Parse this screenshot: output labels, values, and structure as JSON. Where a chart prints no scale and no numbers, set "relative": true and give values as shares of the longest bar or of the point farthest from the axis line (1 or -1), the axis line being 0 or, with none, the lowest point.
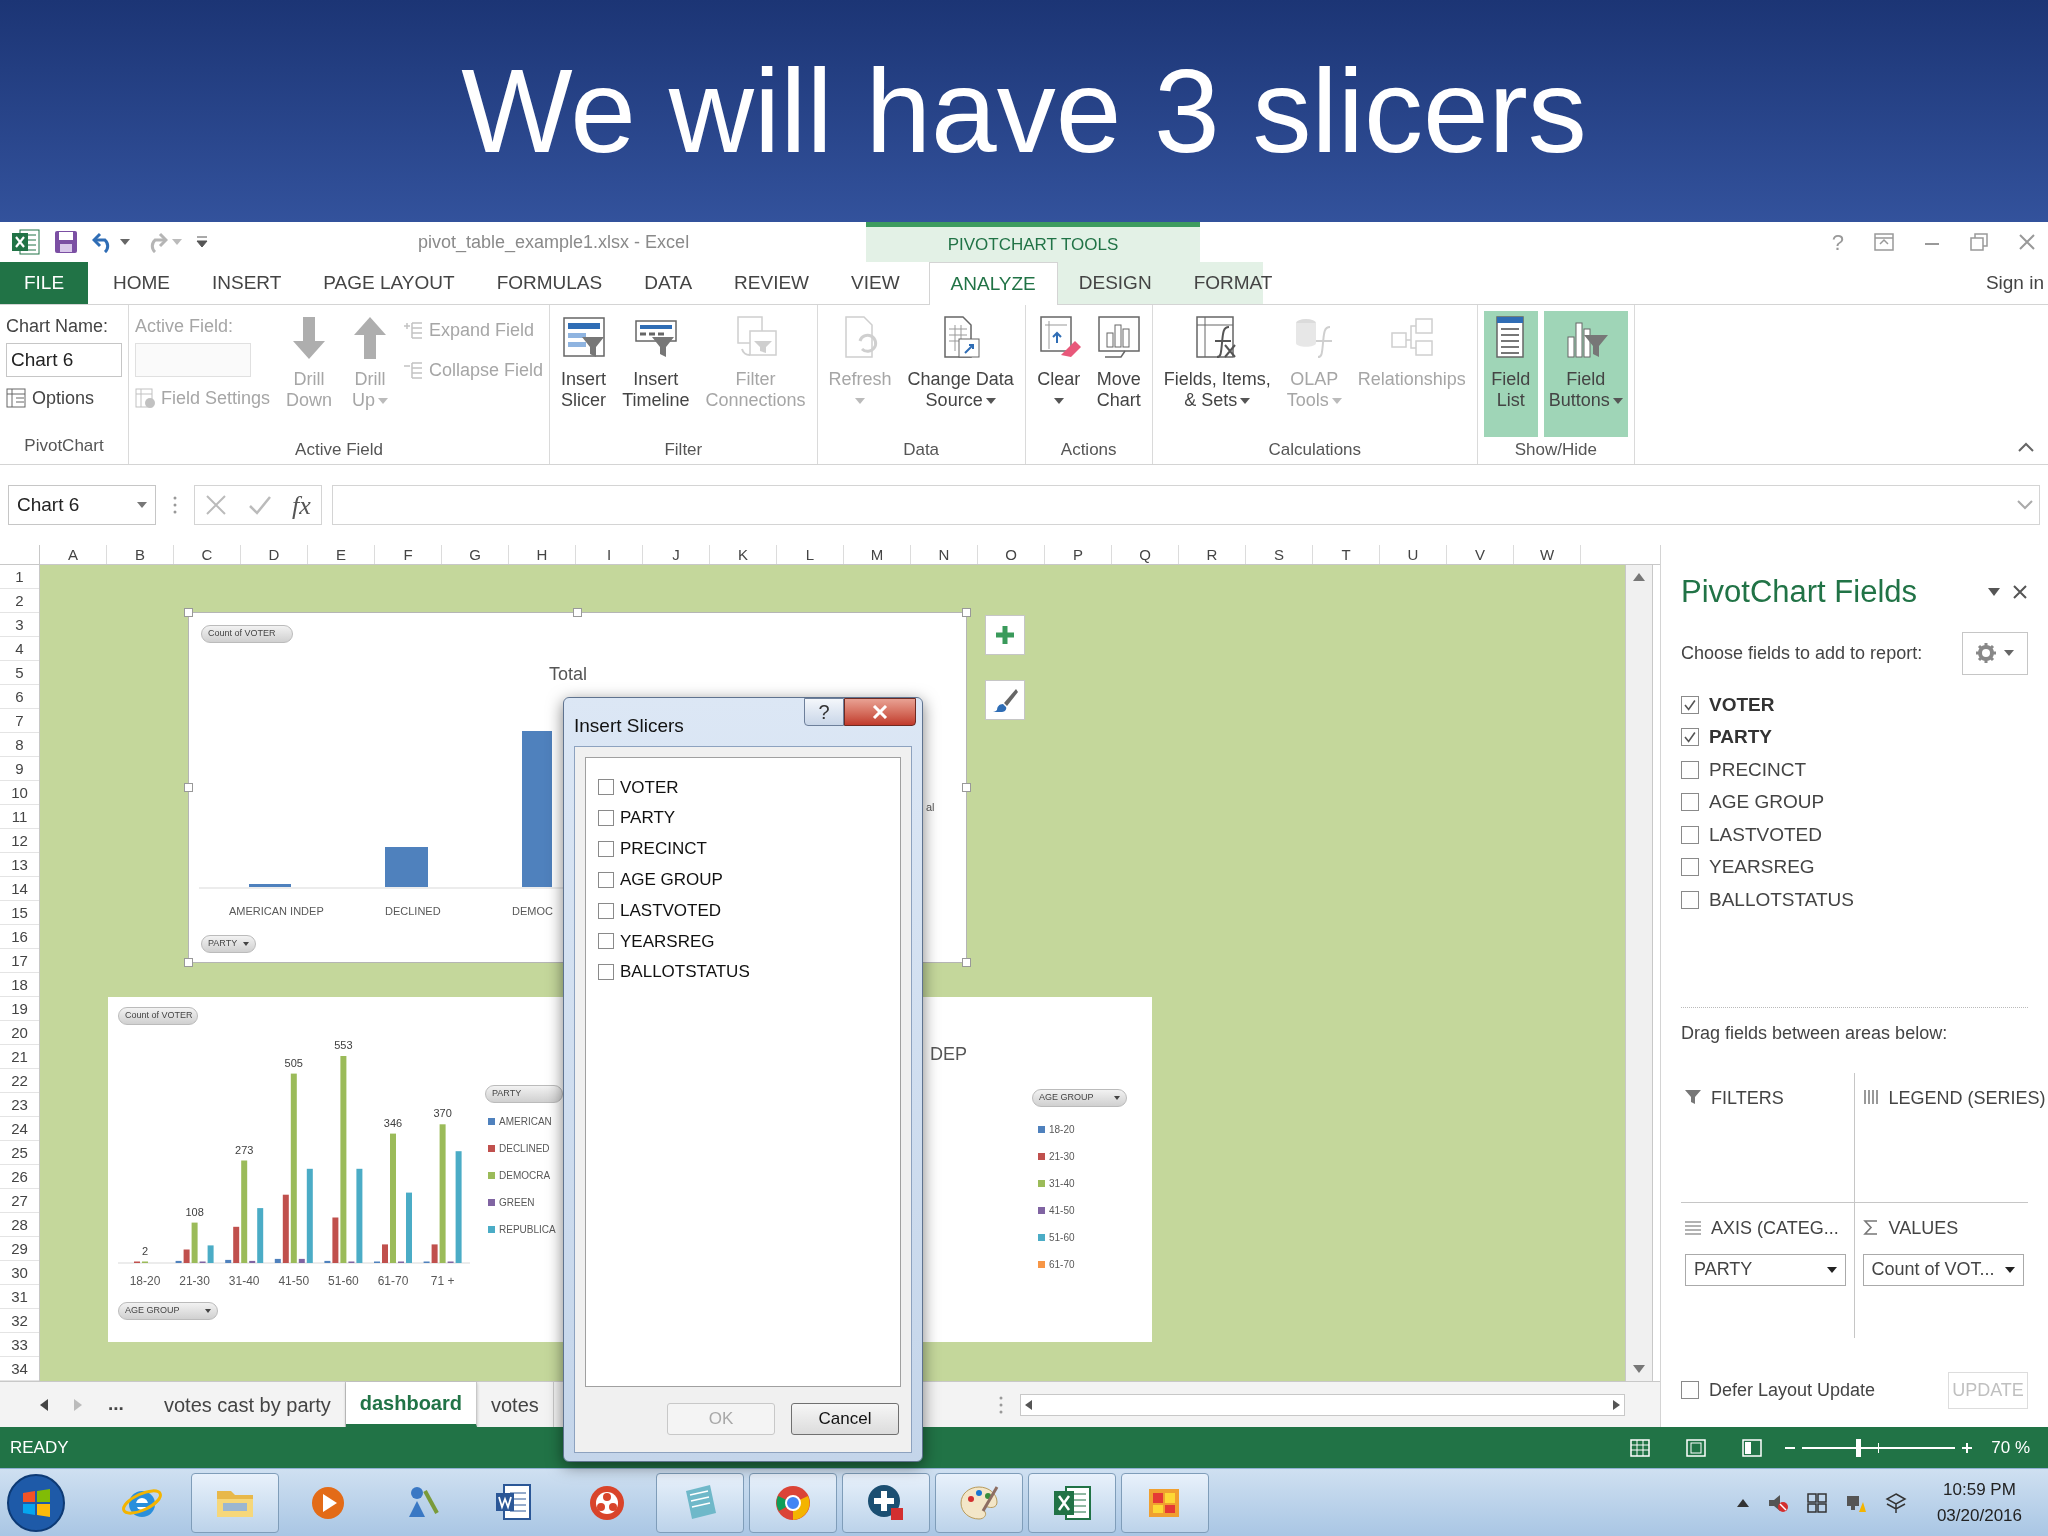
{
  "slide_title": "We will have 3 slicers",
  "title_bar": {
    "document_title": "pivot_table_example1.xlsx - Excel",
    "context_header": "PIVOTCHART TOOLS",
    "help": "?",
    "sign_in": "Sign in"
  },
  "ribbon_tabs": [
    {
      "label": "FILE",
      "kind": "file",
      "selected": false
    },
    {
      "label": "HOME",
      "kind": "tab",
      "selected": false
    },
    {
      "label": "INSERT",
      "kind": "tab",
      "selected": false
    },
    {
      "label": "PAGE LAYOUT",
      "kind": "tab",
      "selected": false
    },
    {
      "label": "FORMULAS",
      "kind": "tab",
      "selected": false
    },
    {
      "label": "DATA",
      "kind": "tab",
      "selected": false
    },
    {
      "label": "REVIEW",
      "kind": "tab",
      "selected": false
    },
    {
      "label": "VIEW",
      "kind": "tab",
      "selected": false
    },
    {
      "label": "ANALYZE",
      "kind": "context",
      "selected": true
    },
    {
      "label": "DESIGN",
      "kind": "context",
      "selected": false
    },
    {
      "label": "FORMAT",
      "kind": "context",
      "selected": false
    }
  ],
  "ribbon_groups": [
    {
      "label": "PivotChart",
      "columns": [
        [
          {
            "kind": "label",
            "text": "Chart Name:",
            "disabled": false
          },
          {
            "kind": "input",
            "value": "Chart 6",
            "disabled": false
          },
          {
            "kind": "small",
            "label": "Options",
            "disabled": false
          }
        ]
      ]
    },
    {
      "label": "Active Field",
      "columns": [
        [
          {
            "kind": "label",
            "text": "Active Field:",
            "disabled": true
          },
          {
            "kind": "input",
            "disabled": true
          },
          {
            "kind": "small",
            "label": "Field Settings",
            "disabled": true
          }
        ],
        [
          {
            "kind": "large",
            "label_lines": [
              "Drill",
              "Down"
            ],
            "disabled": true,
            "dropdown": false,
            "pressed": false
          }
        ],
        [
          {
            "kind": "large",
            "label_lines": [
              "Drill",
              "Up"
            ],
            "disabled": true,
            "dropdown": true,
            "pressed": false
          }
        ],
        [
          {
            "kind": "small",
            "label": "Expand Field",
            "disabled": true
          },
          {
            "kind": "small",
            "label": "Collapse Field",
            "disabled": true
          }
        ]
      ]
    },
    {
      "label": "Filter",
      "columns": [
        [
          {
            "kind": "large",
            "label_lines": [
              "Insert",
              "Slicer"
            ],
            "disabled": false,
            "dropdown": false,
            "pressed": false
          }
        ],
        [
          {
            "kind": "large",
            "label_lines": [
              "Insert",
              "Timeline"
            ],
            "disabled": false,
            "dropdown": false,
            "pressed": false
          }
        ],
        [
          {
            "kind": "large",
            "label_lines": [
              "Filter",
              "Connections"
            ],
            "disabled": true,
            "dropdown": false,
            "pressed": false
          }
        ]
      ]
    },
    {
      "label": "Data",
      "columns": [
        [
          {
            "kind": "large",
            "label_lines": [
              "Refresh"
            ],
            "disabled": true,
            "dropdown": true,
            "pressed": false
          }
        ],
        [
          {
            "kind": "large",
            "label_lines": [
              "Change Data",
              "Source"
            ],
            "disabled": false,
            "dropdown": true,
            "pressed": false
          }
        ]
      ]
    },
    {
      "label": "Actions",
      "columns": [
        [
          {
            "kind": "large",
            "label_lines": [
              "Clear"
            ],
            "disabled": false,
            "dropdown": true,
            "pressed": false
          }
        ],
        [
          {
            "kind": "large",
            "label_lines": [
              "Move",
              "Chart"
            ],
            "disabled": false,
            "dropdown": false,
            "pressed": false
          }
        ]
      ]
    },
    {
      "label": "Calculations",
      "columns": [
        [
          {
            "kind": "large",
            "label_lines": [
              "Fields, Items,",
              "& Sets"
            ],
            "disabled": false,
            "dropdown": true,
            "pressed": false
          }
        ],
        [
          {
            "kind": "large",
            "label_lines": [
              "OLAP",
              "Tools"
            ],
            "disabled": true,
            "dropdown": true,
            "pressed": false
          }
        ],
        [
          {
            "kind": "large",
            "label_lines": [
              "Relationships"
            ],
            "disabled": true,
            "dropdown": false,
            "pressed": false
          }
        ]
      ]
    },
    {
      "label": "Show/Hide",
      "columns": [
        [
          {
            "kind": "large",
            "label_lines": [
              "Field",
              "List"
            ],
            "disabled": false,
            "dropdown": false,
            "pressed": true
          }
        ],
        [
          {
            "kind": "large",
            "label_lines": [
              "Field",
              "Buttons"
            ],
            "disabled": false,
            "dropdown": true,
            "pressed": true
          }
        ]
      ]
    }
  ],
  "formula_bar": {
    "name_box": "Chart 6",
    "function_button": "fx"
  },
  "columns": [
    "A",
    "B",
    "C",
    "D",
    "E",
    "F",
    "G",
    "H",
    "I",
    "J",
    "K",
    "L",
    "M",
    "N",
    "O",
    "P",
    "Q",
    "R",
    "S",
    "T",
    "U",
    "V",
    "W"
  ],
  "rows": [
    "1",
    "2",
    "3",
    "4",
    "5",
    "6",
    "7",
    "8",
    "9",
    "10",
    "11",
    "12",
    "13",
    "14",
    "15",
    "16",
    "17",
    "18",
    "19",
    "20",
    "21",
    "22",
    "23",
    "24",
    "25",
    "26",
    "27",
    "28",
    "29",
    "30",
    "31",
    "32",
    "33",
    "34"
  ],
  "top_chart": {
    "value_button": "Count of VOTER",
    "title": "Total",
    "categories": [
      "AMERICAN INDEP",
      "DECLINED",
      "DEMOC"
    ],
    "axis_button": "PARTY",
    "legend_fragment": "al"
  },
  "bottom_chart": {
    "value_button": "Count of VOTER",
    "axis_button": "AGE GROUP",
    "legend_button": "PARTY",
    "chart_data": {
      "type": "bar",
      "relative": true,
      "categories": [
        "18-20",
        "21-30",
        "31-40",
        "41-50",
        "51-60",
        "61-70",
        "71 +"
      ],
      "series": [
        {
          "name": "AMERICAN",
          "color": "#4f81bd",
          "values": [
            0,
            0.01,
            0.015,
            0.02,
            0.01,
            0.005,
            0.005
          ]
        },
        {
          "name": "DECLINED",
          "color": "#c0504d",
          "values": [
            0.005,
            0.065,
            0.175,
            0.33,
            0.22,
            0.09,
            0.09
          ]
        },
        {
          "name": "DEMOCRA",
          "color": "#9bbb59",
          "values": [
            0.005,
            0.195,
            0.495,
            0.915,
            1,
            0.625,
            0.67
          ]
        },
        {
          "name": "GREEN",
          "color": "#8064a2",
          "values": [
            0,
            0.005,
            0.01,
            0.02,
            0.005,
            0.005,
            0.005
          ]
        },
        {
          "name": "REPUBLICA",
          "color": "#4bacc6",
          "values": [
            0,
            0.085,
            0.265,
            0.455,
            0.455,
            0.34,
            0.54
          ]
        }
      ],
      "value_labels": [
        "2",
        "108",
        "273",
        "505",
        "553",
        "346",
        "370"
      ]
    }
  },
  "side_chart": {
    "title_fragment": "DEP",
    "legend_button": "AGE GROUP",
    "legend": [
      {
        "label": "18-20",
        "color": "#4f81bd"
      },
      {
        "label": "21-30",
        "color": "#c0504d"
      },
      {
        "label": "31-40",
        "color": "#9bbb59"
      },
      {
        "label": "41-50",
        "color": "#8064a2"
      },
      {
        "label": "51-60",
        "color": "#4bacc6"
      },
      {
        "label": "61-70",
        "color": "#f79646"
      }
    ]
  },
  "dialog": {
    "title": "Insert Slicers",
    "help": "?",
    "fields": [
      {
        "label": "VOTER",
        "checked": false
      },
      {
        "label": "PARTY",
        "checked": false
      },
      {
        "label": "PRECINCT",
        "checked": false
      },
      {
        "label": "AGE GROUP",
        "checked": false
      },
      {
        "label": "LASTVOTED",
        "checked": false
      },
      {
        "label": "YEARSREG",
        "checked": false
      },
      {
        "label": "BALLOTSTATUS",
        "checked": false
      }
    ],
    "buttons": [
      {
        "label": "OK",
        "disabled": true
      },
      {
        "label": "Cancel",
        "disabled": false
      }
    ]
  },
  "field_pane": {
    "title": "PivotChart Fields",
    "subtitle": "Choose fields to add to report:",
    "fields": [
      {
        "label": "VOTER",
        "checked": true
      },
      {
        "label": "PARTY",
        "checked": true
      },
      {
        "label": "PRECINCT",
        "checked": false
      },
      {
        "label": "AGE GROUP",
        "checked": false
      },
      {
        "label": "LASTVOTED",
        "checked": false
      },
      {
        "label": "YEARSREG",
        "checked": false
      },
      {
        "label": "BALLOTSTATUS",
        "checked": false
      }
    ],
    "areas_hint": "Drag fields between areas below:",
    "areas": [
      {
        "label": "FILTERS"
      },
      {
        "label": "LEGEND (SERIES)"
      },
      {
        "label": "AXIS (CATEG...",
        "field": "PARTY"
      },
      {
        "label": "VALUES",
        "field": "Count of VOT..."
      }
    ],
    "defer": {
      "label": "Defer Layout Update",
      "checked": false
    },
    "update_button": {
      "label": "UPDATE",
      "disabled": true
    }
  },
  "sheet_nav": "...",
  "sheet_tabs": [
    {
      "label": "votes cast by party",
      "selected": false
    },
    {
      "label": "dashboard",
      "selected": true
    },
    {
      "label": "votes",
      "selected": false
    }
  ],
  "status_bar": {
    "status": "READY",
    "zoom": "70 %",
    "zoom_slider": {
      "level": 0.36
    }
  },
  "taskbar": {
    "apps": [
      {
        "running": false
      },
      {
        "running": true
      },
      {
        "running": false
      },
      {
        "running": false
      },
      {
        "running": false
      },
      {
        "running": false
      },
      {
        "running": true
      },
      {
        "running": true
      },
      {
        "running": true
      },
      {
        "running": true
      },
      {
        "running": true
      },
      {
        "running": true
      }
    ],
    "time": "10:59 PM",
    "date": "03/20/2016"
  }
}
